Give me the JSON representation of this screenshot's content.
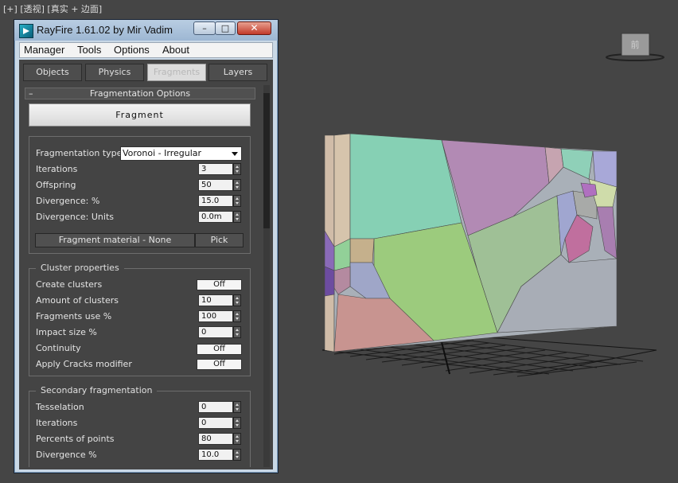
{
  "viewport": {
    "label_plus": "[+]",
    "label_view": "[透视]",
    "label_shading": "[真实 + 边面]",
    "viewcube_text": "前"
  },
  "window": {
    "title": "RayFire 1.61.02  by Mir Vadim",
    "minimize_glyph": "–",
    "maximize_glyph": "□",
    "close_glyph": "✕"
  },
  "menu": [
    {
      "label": "Manager"
    },
    {
      "label": "Tools"
    },
    {
      "label": "Options"
    },
    {
      "label": "About"
    }
  ],
  "tabs": [
    {
      "label": "Objects",
      "active": false
    },
    {
      "label": "Physics",
      "active": false
    },
    {
      "label": "Fragments",
      "active": true
    },
    {
      "label": "Layers",
      "active": false
    }
  ],
  "rollout": {
    "collapse_glyph": "–",
    "title": "Fragmentation Options",
    "fragment_button": "Fragment"
  },
  "fragmentation": {
    "type_label": "Fragmentation type",
    "type_value": "Voronoi - Irregular",
    "rows": [
      {
        "label": "Iterations",
        "value": "3"
      },
      {
        "label": "Offspring",
        "value": "50"
      },
      {
        "label": "Divergence: %",
        "value": "15.0"
      },
      {
        "label": "Divergence: Units",
        "value": "0.0m"
      }
    ],
    "material_button": "Fragment material - None",
    "pick_button": "Pick"
  },
  "cluster": {
    "title": "Cluster properties",
    "rows": [
      {
        "label": "Create clusters",
        "kind": "toggle",
        "value": "Off"
      },
      {
        "label": "Amount of clusters",
        "kind": "spin",
        "value": "10"
      },
      {
        "label": "Fragments use %",
        "kind": "spin",
        "value": "100"
      },
      {
        "label": "Impact size %",
        "kind": "spin",
        "value": "0"
      },
      {
        "label": "Continuity",
        "kind": "toggle",
        "value": "Off"
      },
      {
        "label": "Apply Cracks modifier",
        "kind": "toggle",
        "value": "Off"
      }
    ]
  },
  "secondary": {
    "title": "Secondary fragmentation",
    "rows": [
      {
        "label": "Tesselation",
        "value": "0"
      },
      {
        "label": "Iterations",
        "value": "0"
      },
      {
        "label": "Percents of points",
        "value": "80"
      },
      {
        "label": "Divergence %",
        "value": "10.0"
      }
    ]
  },
  "colors": {
    "viewport_bg": "#454545",
    "panel_bg": "#444444",
    "title_bar": "#9db7d3",
    "close_red": "#c23a2a"
  },
  "icons": {
    "app": "rayfire-logo-icon",
    "viewcube": "viewcube-icon"
  }
}
